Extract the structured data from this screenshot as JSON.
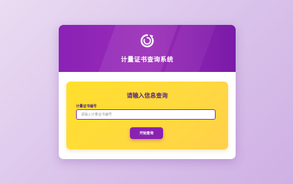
{
  "header": {
    "logo_icon": "refresh-circle-icon",
    "title": "计量证书查询系统"
  },
  "form": {
    "heading": "请输入信息查询",
    "certificate_label": "计量证书编号",
    "certificate_placeholder": "请输入计量证书编号",
    "certificate_value": "",
    "submit_label": "开始查询"
  },
  "colors": {
    "header_purple": "#8a22b6",
    "panel_yellow": "#ffdf2c",
    "button_purple": "#8a22b0",
    "text_purple": "#5a2a7a"
  }
}
